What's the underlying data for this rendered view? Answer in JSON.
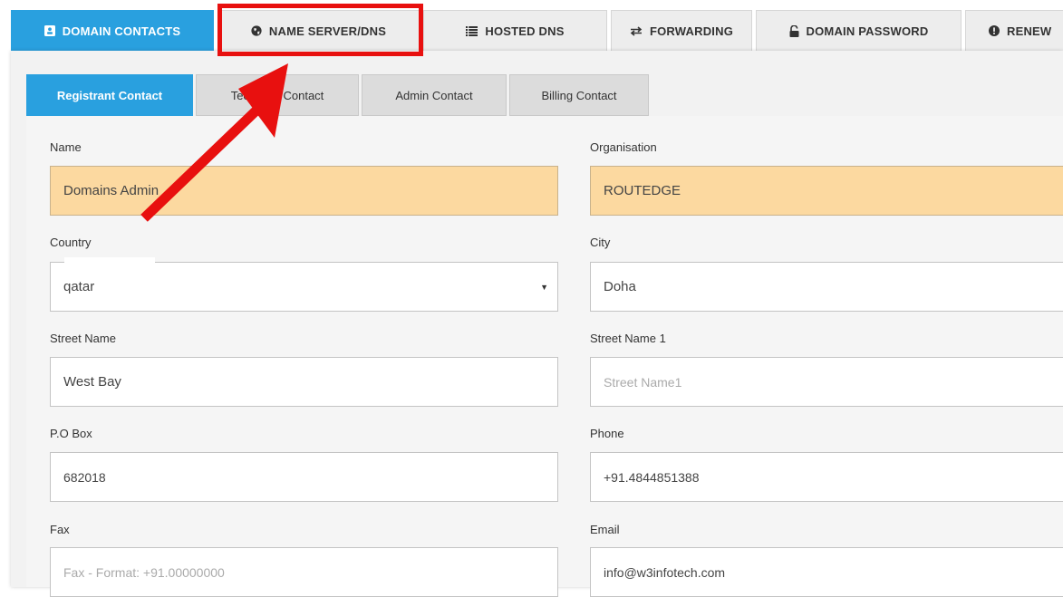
{
  "top_tabs": [
    {
      "label": "DOMAIN CONTACTS",
      "icon": "contact-card-icon",
      "active": true
    },
    {
      "label": "NAME SERVER/DNS",
      "icon": "globe-icon",
      "active": false
    },
    {
      "label": "HOSTED DNS",
      "icon": "server-list-icon",
      "active": false
    },
    {
      "label": "FORWARDING",
      "icon": "exchange-arrows-icon",
      "active": false
    },
    {
      "label": "DOMAIN PASSWORD",
      "icon": "unlock-icon",
      "active": false
    },
    {
      "label": "RENEW",
      "icon": "info-circle-icon",
      "active": false
    }
  ],
  "sub_tabs": [
    {
      "label": "Registrant Contact",
      "active": true
    },
    {
      "label": "Technical Contact",
      "active": false
    },
    {
      "label": "Admin Contact",
      "active": false
    },
    {
      "label": "Billing Contact",
      "active": false
    }
  ],
  "form": {
    "name": {
      "label": "Name",
      "value": "Domains Admin"
    },
    "organisation": {
      "label": "Organisation",
      "value": "ROUTEDGE"
    },
    "country": {
      "label": "Country",
      "value": "qatar"
    },
    "city": {
      "label": "City",
      "value": "Doha"
    },
    "street_name": {
      "label": "Street Name",
      "value": "West Bay"
    },
    "street_name_1": {
      "label": "Street Name 1",
      "placeholder": "Street Name1"
    },
    "po_box": {
      "label": "P.O Box",
      "value": "682018"
    },
    "phone": {
      "label": "Phone",
      "value": "+91.4844851388"
    },
    "fax": {
      "label": "Fax",
      "placeholder": "Fax - Format: +91.00000000"
    },
    "email": {
      "label": "Email",
      "value": "info@w3infotech.com"
    }
  },
  "colors": {
    "accent": "#29a0df",
    "highlight_field": "#fcd9a0",
    "annotation": "#e8100f"
  }
}
